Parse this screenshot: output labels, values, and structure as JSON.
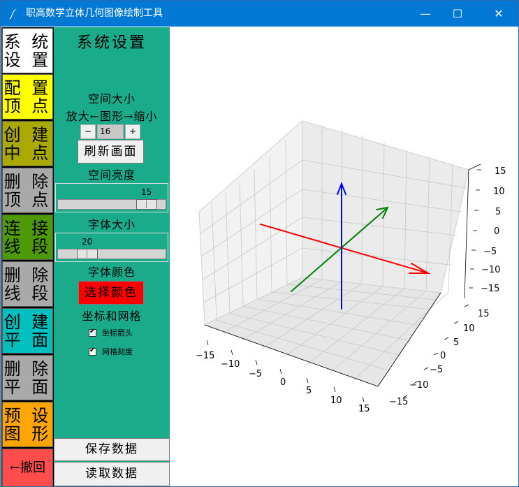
{
  "window": {
    "title": "职高数学立体几何图像绘制工具",
    "minimize": "—",
    "maximize": "☐",
    "close": "✕"
  },
  "tabs": [
    {
      "label": "系 统\n设 置",
      "color": "#ffffff"
    },
    {
      "label": "配 置\n顶 点",
      "color": "#ffff00"
    },
    {
      "label": "创 建\n中 点",
      "color": "#a9a900"
    },
    {
      "label": "删 除\n顶 点",
      "color": "#a9a9a9"
    },
    {
      "label": "连 接\n线 段",
      "color": "#4e9a06"
    },
    {
      "label": "删 除\n线 段",
      "color": "#a9a9a9"
    },
    {
      "label": "创 建\n平 面",
      "color": "#00bfbf"
    },
    {
      "label": "删 除\n平 面",
      "color": "#a9a9a9"
    },
    {
      "label": "预 设\n图 形",
      "color": "#ffa500"
    },
    {
      "label": "←撤回",
      "color": "#ff4d4d"
    }
  ],
  "settings": {
    "title": "系统设置",
    "space_size_label": "空间大小",
    "zoom_hint": "放大←图形→缩小",
    "spin_minus": "−",
    "spin_plus": "+",
    "space_size_value": "16",
    "refresh_button": "刷新画面",
    "brightness_label": "空间亮度",
    "brightness_value": "15",
    "brightness_fraction": 0.9,
    "font_size_label": "字体大小",
    "font_size_value": "20",
    "font_size_fraction": 0.22,
    "font_color_label": "字体颜色",
    "choose_color_button": "选择颜色",
    "choose_color_bg": "#ff0000",
    "axes_grid_label": "坐标和网格",
    "axis_arrow_check": "坐标箭头",
    "axis_arrow_checked": true,
    "grid_ticks_check": "网格刻度",
    "grid_ticks_checked": true,
    "save_button": "保存数据",
    "load_button": "读取数据"
  },
  "plot": {
    "x_ticks": [
      "−15",
      "−10",
      "−5",
      "0",
      "5",
      "10",
      "15"
    ],
    "y_ticks": [
      "15",
      "10",
      "5",
      "0",
      "−5",
      "−10",
      "−15"
    ],
    "z_ticks": [
      "15",
      "10",
      "5",
      "0",
      "−5",
      "−10",
      "−15"
    ],
    "axis_x_color": "#ff0000",
    "axis_y_color": "#008000",
    "axis_z_color": "#0000ff"
  },
  "colors": {
    "titlebar": "#0078d4",
    "panel": "#1aab8b"
  }
}
